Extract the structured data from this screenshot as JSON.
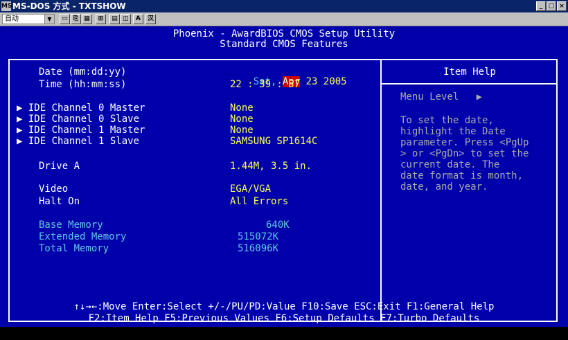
{
  "window": {
    "title": "MS-DOS 方式 - TXTSHOW",
    "buttons": [
      "_",
      "□",
      "×"
    ]
  },
  "toolbar": {
    "font_select": "自动",
    "font_select_arrow": "▼",
    "buttons": [
      "▭",
      "⎘",
      "▦",
      "⊞",
      "▤",
      "◫",
      "A",
      "汉"
    ]
  },
  "bios": {
    "header_line1": "Phoenix - AwardBIOS CMOS Setup Utility",
    "header_line2": "Standard CMOS Features",
    "date_label": "Date (mm:dd:yy)",
    "date_day": "Sat,",
    "date_month": "Apr",
    "date_rest": "23 2005",
    "time_label": "Time (hh:mm:ss)",
    "time_value": "22 : 39 : 57",
    "ide": [
      {
        "label": "▶ IDE Channel 0 Master",
        "value": "None"
      },
      {
        "label": "▶ IDE Channel 0 Slave",
        "value": "None"
      },
      {
        "label": "▶ IDE Channel 1 Master",
        "value": "None"
      },
      {
        "label": "▶ IDE Channel 1 Slave",
        "value": "SAMSUNG SP1614C"
      }
    ],
    "drive_a_label": "Drive A",
    "drive_a_value": "1.44M, 3.5 in.",
    "video_label": "Video",
    "video_value": "EGA/VGA",
    "halt_label": "Halt On",
    "halt_value": "All Errors",
    "base_mem_label": "Base Memory",
    "base_mem_value": "640K",
    "ext_mem_label": "Extended Memory",
    "ext_mem_value": "515072K",
    "total_mem_label": "Total Memory",
    "total_mem_value": "516096K",
    "help_title": "Item Help",
    "menu_level": "Menu Level   ▶",
    "help_lines": [
      "To set the date,",
      "highlight the Date",
      "parameter. Press <PgUp",
      "> or <PgDn> to set the",
      "current date. The",
      "date format is month,",
      "date, and year."
    ],
    "footer_line1": "↑↓→←:Move  Enter:Select  +/-/PU/PD:Value  F10:Save  ESC:Exit  F1:General Help",
    "footer_line2": "F2:Item Help F5:Previous Values F6:Setup Defaults F7:Turbo Defaults"
  },
  "colors": {
    "bios_bg": "#0000aa",
    "value_yellow": "#ffff55",
    "readonly_cyan": "#55c8ff",
    "selected_red": "#c80000"
  }
}
